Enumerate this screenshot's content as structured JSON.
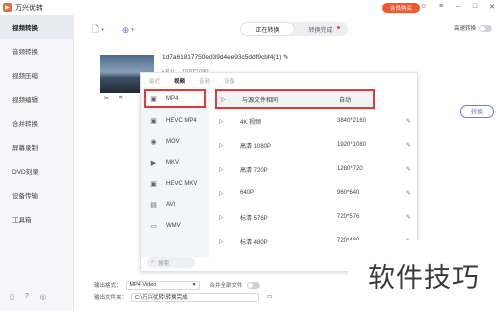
{
  "app": {
    "title": "万兴优转",
    "vip_label": "会员购买"
  },
  "window_icons": [
    "user-icon",
    "list-icon",
    "minimize-icon",
    "maximize-icon",
    "close-icon"
  ],
  "sidebar": {
    "items": [
      {
        "label": "视频转换",
        "active": true
      },
      {
        "label": "音频转换",
        "active": false
      },
      {
        "label": "视频压缩",
        "active": false
      },
      {
        "label": "视频编辑",
        "active": false
      },
      {
        "label": "合并转换",
        "active": false
      },
      {
        "label": "屏幕录制",
        "active": false
      },
      {
        "label": "DVD刻录",
        "active": false
      },
      {
        "label": "设备传输",
        "active": false
      },
      {
        "label": "工具箱",
        "active": false
      }
    ]
  },
  "toolbar": {
    "segments": [
      "正在转换",
      "转换完成"
    ],
    "hw_accel_label": "高速转换"
  },
  "file": {
    "name": "1d7a61817750ed39d4ee93c5ddf9cbf4(1)",
    "meta": "• P V ... 1920*1080"
  },
  "convert_label": "转换",
  "dropdown": {
    "tabs": [
      "最近",
      "视频",
      "音频",
      "设备"
    ],
    "active_tab": "视频",
    "formats": [
      "MP4",
      "HEVC MP4",
      "MOV",
      "MKV",
      "HEVC MKV",
      "AVI",
      "WMV"
    ],
    "selected_format": "MP4",
    "qualities": [
      {
        "name": "与源文件相同",
        "res": "自动"
      },
      {
        "name": "4K 视频",
        "res": "3840*2160"
      },
      {
        "name": "高清 1080P",
        "res": "1920*1080"
      },
      {
        "name": "高清 720P",
        "res": "1280*720"
      },
      {
        "name": "640P",
        "res": "960*640"
      },
      {
        "name": "标清 576P",
        "res": "720*576"
      },
      {
        "name": "标清 480P",
        "res": "720*480"
      }
    ],
    "search_placeholder": "搜索"
  },
  "bottom": {
    "format_label": "输出格式：",
    "format_value": "MP4 Video",
    "merge_label": "合并全部文件",
    "folder_label": "输出文件夹：",
    "folder_value": "C:\\万兴优转\\转换完成"
  },
  "watermark": "软件技巧"
}
